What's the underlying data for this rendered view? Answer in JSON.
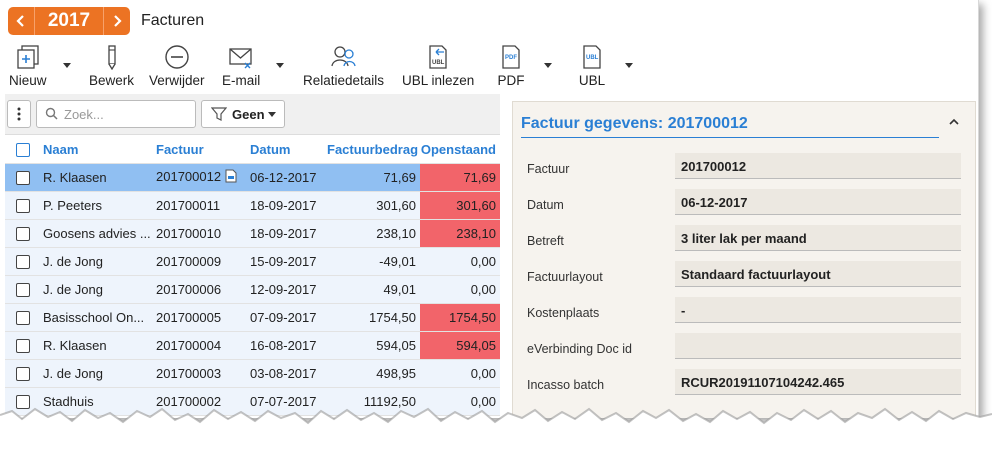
{
  "header": {
    "year": "2017",
    "prev_icon": "chevron-left-icon",
    "next_icon": "chevron-right-icon",
    "title": "Facturen"
  },
  "toolbar": {
    "items": [
      {
        "label": "Nieuw",
        "icon": "new-document-icon"
      },
      {
        "label": "Bewerk",
        "icon": "pencil-icon"
      },
      {
        "label": "Verwijder",
        "icon": "minus-circle-icon"
      },
      {
        "label": "E-mail",
        "icon": "envelope-icon"
      },
      {
        "label": "Relatiedetails",
        "icon": "contacts-icon"
      },
      {
        "label": "UBL inlezen",
        "icon": "ubl-import-icon"
      },
      {
        "label": "PDF",
        "icon": "pdf-file-icon"
      },
      {
        "label": "UBL",
        "icon": "ubl-file-icon"
      }
    ]
  },
  "grid": {
    "search_placeholder": "Zoek...",
    "filter_label": "Geen",
    "columns": [
      "Naam",
      "Factuur",
      "Datum",
      "Factuurbedrag",
      "Openstaand"
    ],
    "rows": [
      {
        "naam": "R. Klaasen",
        "factuur": "201700012",
        "datum": "06-12-2017",
        "bedrag": "71,69",
        "open": "71,69",
        "open_red": true,
        "selected": true,
        "pdf": true
      },
      {
        "naam": "P. Peeters",
        "factuur": "201700011",
        "datum": "18-09-2017",
        "bedrag": "301,60",
        "open": "301,60",
        "open_red": true
      },
      {
        "naam": "Goosens advies ...",
        "factuur": "201700010",
        "datum": "18-09-2017",
        "bedrag": "238,10",
        "open": "238,10",
        "open_red": true
      },
      {
        "naam": "J. de Jong",
        "factuur": "201700009",
        "datum": "15-09-2017",
        "bedrag": "-49,01",
        "open": "0,00",
        "open_red": false
      },
      {
        "naam": "J. de Jong",
        "factuur": "201700006",
        "datum": "12-09-2017",
        "bedrag": "49,01",
        "open": "0,00",
        "open_red": false
      },
      {
        "naam": "Basisschool On...",
        "factuur": "201700005",
        "datum": "07-09-2017",
        "bedrag": "1754,50",
        "open": "1754,50",
        "open_red": true
      },
      {
        "naam": "R. Klaasen",
        "factuur": "201700004",
        "datum": "16-08-2017",
        "bedrag": "594,05",
        "open": "594,05",
        "open_red": true
      },
      {
        "naam": "J. de Jong",
        "factuur": "201700003",
        "datum": "03-08-2017",
        "bedrag": "498,95",
        "open": "0,00",
        "open_red": false
      },
      {
        "naam": "Stadhuis",
        "factuur": "201700002",
        "datum": "07-07-2017",
        "bedrag": "11192,50",
        "open": "0,00",
        "open_red": false
      }
    ]
  },
  "panel": {
    "title": "Factuur gegevens: 201700012",
    "fields": [
      {
        "label": "Factuur",
        "value": "201700012"
      },
      {
        "label": "Datum",
        "value": "06-12-2017"
      },
      {
        "label": "Betreft",
        "value": "3 liter lak per maand"
      },
      {
        "label": "Factuurlayout",
        "value": "Standaard factuurlayout"
      },
      {
        "label": "Kostenplaats",
        "value": "-"
      },
      {
        "label": "eVerbinding Doc id",
        "value": ""
      },
      {
        "label": "Incasso batch",
        "value": "RCUR20191107104242.465"
      }
    ]
  },
  "colors": {
    "accent": "#ec7323",
    "link": "#2a7fd4",
    "selected_row": "#90bff2",
    "outstanding": "#f2646a"
  }
}
